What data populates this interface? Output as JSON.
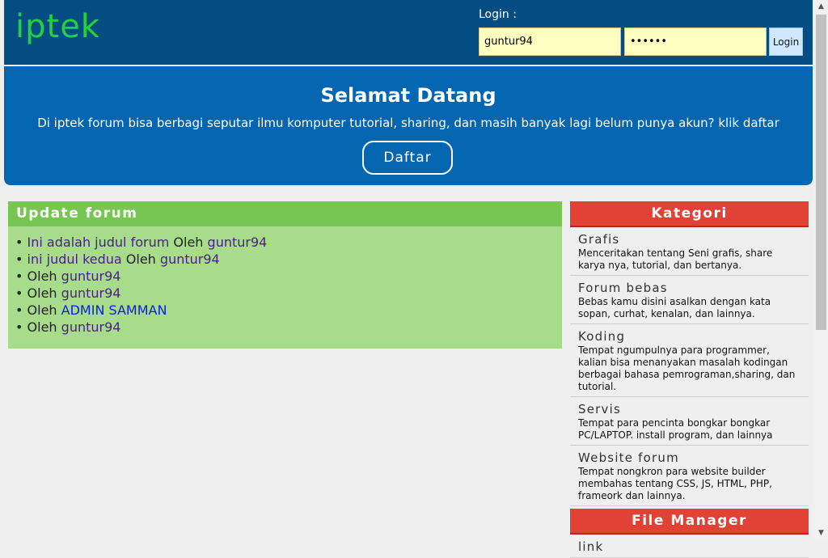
{
  "header": {
    "logo": "iptek",
    "login_label": "Login :",
    "username_value": "guntur94",
    "password_value": "••••••",
    "login_button": "Login"
  },
  "hero": {
    "title": "Selamat Datang",
    "text": "Di iptek forum bisa berbagi seputar ilmu komputer tutorial, sharing, dan masih banyak lagi belum punya akun? klik daftar",
    "daftar_button": "Daftar"
  },
  "update_forum": {
    "title": "Update forum",
    "items": [
      {
        "title": "Ini adalah judul forum",
        "oleh": "Oleh",
        "author": "guntur94"
      },
      {
        "title": "ini judul kedua",
        "oleh": "Oleh",
        "author": "guntur94"
      },
      {
        "title": "",
        "oleh": "Oleh",
        "author": "guntur94"
      },
      {
        "title": "",
        "oleh": "Oleh",
        "author": "guntur94"
      },
      {
        "title": "",
        "oleh": "Oleh",
        "author": "ADMIN SAMMAN"
      },
      {
        "title": "",
        "oleh": "Oleh",
        "author": "guntur94"
      }
    ]
  },
  "kategori": {
    "title": "Kategori",
    "items": [
      {
        "title": "Grafis",
        "desc": "Menceritakan tentang Seni grafis, share karya nya, tutorial, dan bertanya."
      },
      {
        "title": "Forum bebas",
        "desc": "Bebas kamu disini asalkan dengan kata sopan, curhat, kenalan, dan lainnya."
      },
      {
        "title": "Koding",
        "desc": "Tempat ngumpulnya para programmer, kalian bisa menanyakan masalah kodingan berbagai bahasa pemrograman,sharing, dan tutorial."
      },
      {
        "title": "Servis",
        "desc": "Tempat para pencinta bongkar bongkar PC/LAPTOP. install program, dan lainnya"
      },
      {
        "title": "Website forum",
        "desc": "Tempat nongkron para website builder membahas tentang CSS, JS, HTML, PHP, frameork dan lainnya."
      }
    ]
  },
  "file_manager": {
    "title": "File Manager",
    "items": [
      {
        "title": "link"
      }
    ]
  }
}
